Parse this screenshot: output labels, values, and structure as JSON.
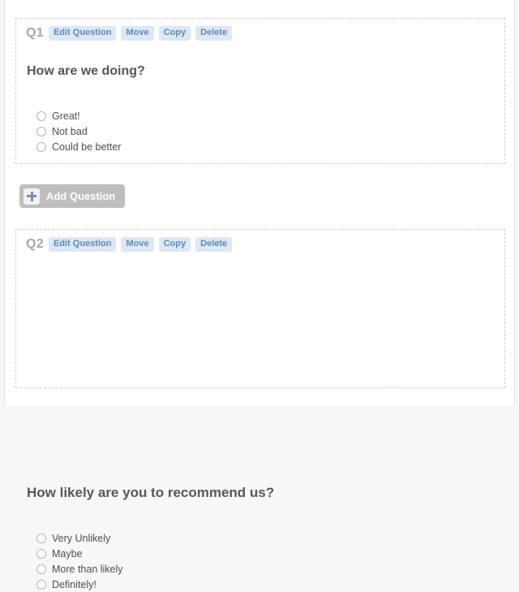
{
  "colors": {
    "page_background": "#f7f7f7",
    "card_background": "#ffffff",
    "panel_border": "#cfcfcf",
    "action_button_background": "#dce8f4",
    "action_button_text": "#5f8ab9",
    "question_number_text": "#a8a8a8",
    "question_title_text": "#575757",
    "option_text": "#4f4f4f",
    "radio_border": "#b6b6b6",
    "add_button_background": "#bebebe",
    "add_button_text": "#ffffff",
    "plus_icon_color": "#6e93b8"
  },
  "questions": [
    {
      "number": "Q1",
      "title": "How are we doing?",
      "actions": [
        {
          "label": "Edit Question",
          "name": "edit-question-button"
        },
        {
          "label": "Move",
          "name": "move-question-button"
        },
        {
          "label": "Copy",
          "name": "copy-question-button"
        },
        {
          "label": "Delete",
          "name": "delete-question-button"
        }
      ],
      "options": [
        {
          "label": "Great!"
        },
        {
          "label": "Not bad"
        },
        {
          "label": "Could be better"
        }
      ]
    },
    {
      "number": "Q2",
      "title": "How likely are you to recommend us?",
      "actions": [
        {
          "label": "Edit Question",
          "name": "edit-question-button"
        },
        {
          "label": "Move",
          "name": "move-question-button"
        },
        {
          "label": "Copy",
          "name": "copy-question-button"
        },
        {
          "label": "Delete",
          "name": "delete-question-button"
        }
      ],
      "options": [
        {
          "label": "Very Unlikely"
        },
        {
          "label": "Maybe"
        },
        {
          "label": "More than likely"
        },
        {
          "label": "Definitely!"
        }
      ]
    }
  ],
  "add_question": {
    "label": "Add Question",
    "icon": "plus-icon"
  }
}
